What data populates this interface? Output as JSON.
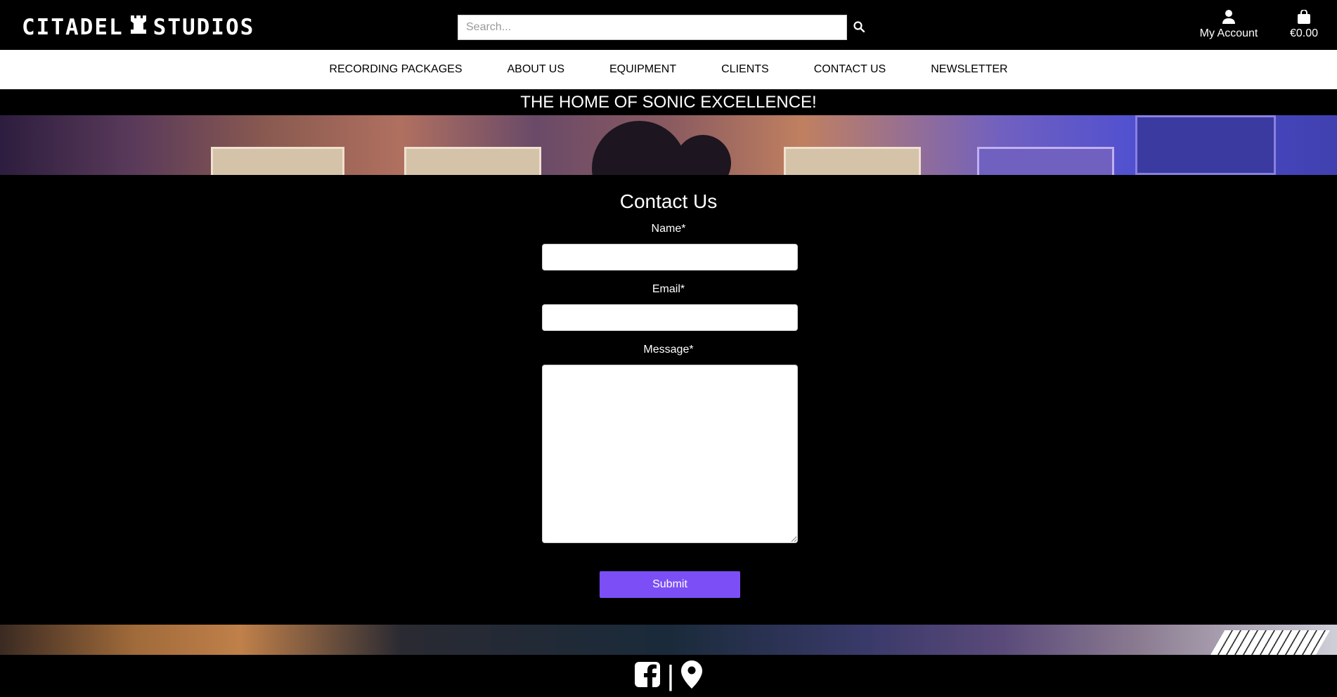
{
  "header": {
    "logo_left": "CITADEL",
    "logo_icon": "rook-icon",
    "logo_right": "STUDIOS",
    "search_placeholder": "Search...",
    "account_label": "My Account",
    "bag_total": "€0.00"
  },
  "nav": {
    "items": [
      {
        "label": "RECORDING PACKAGES"
      },
      {
        "label": "ABOUT US"
      },
      {
        "label": "EQUIPMENT"
      },
      {
        "label": "CLIENTS"
      },
      {
        "label": "CONTACT US"
      },
      {
        "label": "NEWSLETTER"
      }
    ]
  },
  "banner": {
    "tagline": "THE HOME OF SONIC EXCELLENCE!"
  },
  "contact": {
    "title": "Contact Us",
    "name_label": "Name*",
    "email_label": "Email*",
    "message_label": "Message*",
    "submit_label": "Submit",
    "name_value": "",
    "email_value": "",
    "message_value": ""
  },
  "footer": {
    "separator": "|",
    "icons": [
      "facebook-icon",
      "map-marker-icon"
    ]
  },
  "colors": {
    "accent": "#7b4ff5",
    "background": "#000000",
    "nav_background": "#ffffff"
  }
}
